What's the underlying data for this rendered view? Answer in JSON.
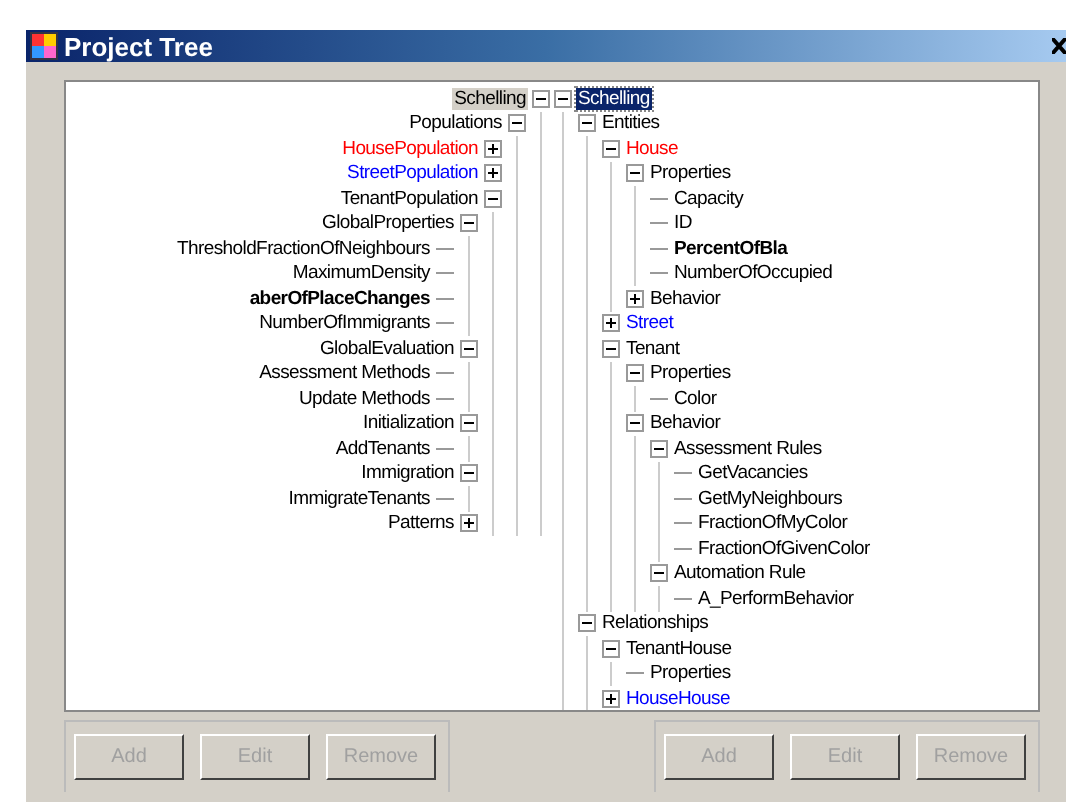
{
  "window": {
    "title": "Project Tree"
  },
  "left_tree": {
    "focused": false,
    "root": {
      "label": "Schelling",
      "selected": true,
      "expanded": true,
      "children": [
        {
          "label": "Populations",
          "selected": false,
          "expanded": true,
          "children": [
            {
              "label": "HousePopulation",
              "selected": false,
              "expanded": false,
              "color": "#ff0000"
            },
            {
              "label": "StreetPopulation",
              "selected": false,
              "expanded": false,
              "color": "#0000ff"
            },
            {
              "label": "TenantPopulation",
              "selected": false,
              "expanded": true,
              "children": [
                {
                  "label": "GlobalProperties",
                  "selected": false,
                  "expanded": true,
                  "children": [
                    {
                      "label": "ThresholdFractionOfNeighbours",
                      "selected": false
                    },
                    {
                      "label": "MaximumDensity",
                      "selected": false
                    },
                    {
                      "label": "aberOfPlaceChanges",
                      "selected": false,
                      "bold": true
                    },
                    {
                      "label": "NumberOfImmigrants",
                      "selected": false
                    }
                  ]
                },
                {
                  "label": "GlobalEvaluation",
                  "selected": false,
                  "expanded": true,
                  "children": [
                    {
                      "label": "Assessment Methods",
                      "selected": false
                    },
                    {
                      "label": "Update Methods",
                      "selected": false
                    }
                  ]
                },
                {
                  "label": "Initialization",
                  "selected": false,
                  "expanded": true,
                  "children": [
                    {
                      "label": "AddTenants",
                      "selected": false
                    }
                  ]
                },
                {
                  "label": "Immigration",
                  "selected": false,
                  "expanded": true,
                  "children": [
                    {
                      "label": "ImmigrateTenants",
                      "selected": false
                    }
                  ]
                },
                {
                  "label": "Patterns",
                  "selected": false,
                  "expanded": false
                }
              ]
            }
          ]
        }
      ]
    }
  },
  "right_tree": {
    "focused": true,
    "root": {
      "label": "Schelling",
      "selected": true,
      "expanded": true,
      "children": [
        {
          "label": "Entities",
          "selected": false,
          "expanded": true,
          "children": [
            {
              "label": "House",
              "selected": false,
              "expanded": true,
              "color": "#ff0000",
              "children": [
                {
                  "label": "Properties",
                  "selected": false,
                  "expanded": true,
                  "children": [
                    {
                      "label": "Capacity",
                      "selected": false
                    },
                    {
                      "label": "ID",
                      "selected": false
                    },
                    {
                      "label": "PercentOfBla",
                      "selected": false,
                      "bold": true
                    },
                    {
                      "label": "NumberOfOccupied",
                      "selected": false
                    }
                  ]
                },
                {
                  "label": "Behavior",
                  "selected": false,
                  "expanded": false
                }
              ]
            },
            {
              "label": "Street",
              "selected": false,
              "expanded": false,
              "color": "#0000ff"
            },
            {
              "label": "Tenant",
              "selected": false,
              "expanded": true,
              "children": [
                {
                  "label": "Properties",
                  "selected": false,
                  "expanded": true,
                  "children": [
                    {
                      "label": "Color",
                      "selected": false
                    }
                  ]
                },
                {
                  "label": "Behavior",
                  "selected": false,
                  "expanded": true,
                  "children": [
                    {
                      "label": "Assessment Rules",
                      "selected": false,
                      "expanded": true,
                      "children": [
                        {
                          "label": "GetVacancies",
                          "selected": false
                        },
                        {
                          "label": "GetMyNeighbours",
                          "selected": false
                        },
                        {
                          "label": "FractionOfMyColor",
                          "selected": false
                        },
                        {
                          "label": "FractionOfGivenColor",
                          "selected": false
                        }
                      ]
                    },
                    {
                      "label": "Automation Rule",
                      "selected": false,
                      "expanded": true,
                      "children": [
                        {
                          "label": "A_PerformBehavior",
                          "selected": false
                        }
                      ]
                    }
                  ]
                }
              ]
            }
          ]
        },
        {
          "label": "Relationships",
          "selected": false,
          "expanded": true,
          "children": [
            {
              "label": "TenantHouse",
              "selected": false,
              "expanded": true,
              "children": [
                {
                  "label": "Properties",
                  "selected": false
                }
              ]
            },
            {
              "label": "HouseHouse",
              "selected": false,
              "expanded": false,
              "color": "#0000ff"
            }
          ]
        }
      ]
    }
  },
  "left_buttons": [
    {
      "label": "Add",
      "disabled": true
    },
    {
      "label": "Edit",
      "disabled": true
    },
    {
      "label": "Remove",
      "disabled": true
    }
  ],
  "right_buttons": [
    {
      "label": "Add",
      "disabled": true
    },
    {
      "label": "Edit",
      "disabled": true
    },
    {
      "label": "Remove",
      "disabled": true
    }
  ]
}
